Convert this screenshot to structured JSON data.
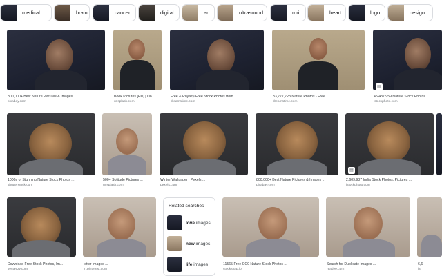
{
  "chips": [
    {
      "label": "medical",
      "icon": "medical-thumb"
    },
    {
      "label": "brain",
      "icon": "brain-thumb"
    },
    {
      "label": "cancer",
      "icon": "cancer-thumb"
    },
    {
      "label": "digital",
      "icon": "digital-thumb"
    },
    {
      "label": "art",
      "icon": "art-thumb"
    },
    {
      "label": "ultrasound",
      "icon": "ultrasound-thumb"
    },
    {
      "label": "mri",
      "icon": "mri-thumb"
    },
    {
      "label": "heart",
      "icon": "heart-thumb"
    },
    {
      "label": "logo",
      "icon": "logo-thumb"
    },
    {
      "label": "design",
      "icon": "design-thumb"
    }
  ],
  "results": {
    "row1": [
      {
        "caption": "800,000+ Best Nature Pictures & Images ...",
        "source": "pixabay.com"
      },
      {
        "caption": "Book Pictures [HD] | Do...",
        "source": "unsplash.com"
      },
      {
        "caption": "Free & Royalty-Free Stock Photos from ...",
        "source": "dreamstime.com"
      },
      {
        "caption": "33,777,723 Nature Photos - Free ...",
        "source": "dreamstime.com"
      },
      {
        "caption": "45,437,959 Nature Stock Photos ...",
        "source": "istockphoto.com"
      }
    ],
    "row2": [
      {
        "caption": "1000s of Stunning Nature Stock Photos ...",
        "source": "shutterstock.com"
      },
      {
        "caption": "500+ Solitude Pictures ...",
        "source": "unsplash.com"
      },
      {
        "caption": "Winter Wallpaper : Pexels ...",
        "source": "pexels.com"
      },
      {
        "caption": "800,000+ Best Nature Pictures & Images ...",
        "source": "pixabay.com"
      },
      {
        "caption": "2,609,937 India Stock Photos, Pictures ...",
        "source": "istockphoto.com"
      }
    ],
    "row3": [
      {
        "caption": "Download Free Stock Photos, Im...",
        "source": "vecteezy.com"
      },
      {
        "caption": "letter images ...",
        "source": "in.pinterest.com"
      },
      {
        "caption": "11565 Free CC0 Nature Stock Photos ...",
        "source": "stocksnap.io"
      },
      {
        "caption": "Search for Duplicate Images ...",
        "source": "readee.com"
      },
      {
        "caption": "6,6",
        "source": "ist"
      }
    ]
  },
  "related": {
    "title": "Related searches",
    "items": [
      {
        "bold": "love",
        "rest": " images"
      },
      {
        "bold": "new",
        "rest": " images"
      },
      {
        "bold": "life",
        "rest": " images"
      }
    ]
  },
  "icons": {
    "badge": "image-badge-icon"
  }
}
